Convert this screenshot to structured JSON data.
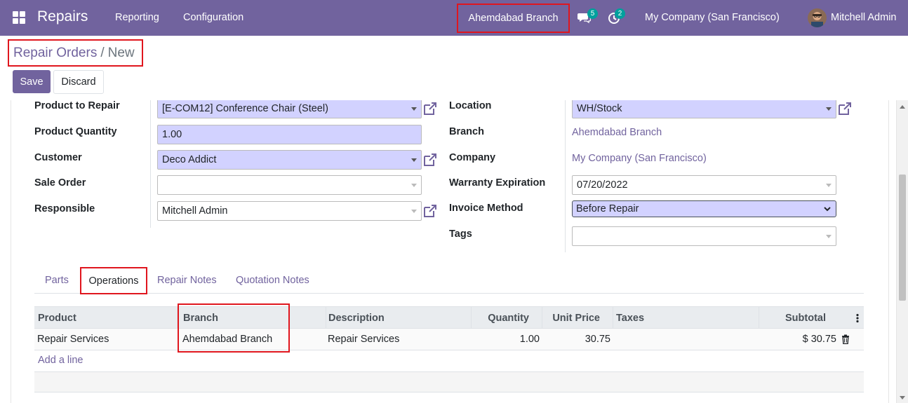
{
  "navbar": {
    "app_name": "Repairs",
    "menus": [
      "Reporting",
      "Configuration"
    ],
    "branch": "Ahemdabad Branch",
    "messages_count": "5",
    "activities_count": "2",
    "company": "My Company (San Francisco)",
    "user": "Mitchell Admin"
  },
  "breadcrumb": {
    "parent": "Repair Orders",
    "separator": "/",
    "current": "New"
  },
  "buttons": {
    "save": "Save",
    "discard": "Discard"
  },
  "form": {
    "left": {
      "product_label": "Product to Repair",
      "product_value": "[E-COM12] Conference Chair (Steel)",
      "qty_label": "Product Quantity",
      "qty_value": "1.00",
      "customer_label": "Customer",
      "customer_value": "Deco Addict",
      "sale_order_label": "Sale Order",
      "sale_order_value": "",
      "responsible_label": "Responsible",
      "responsible_value": "Mitchell Admin"
    },
    "right": {
      "location_label": "Location",
      "location_value": "WH/Stock",
      "branch_label": "Branch",
      "branch_value": "Ahemdabad Branch",
      "company_label": "Company",
      "company_value": "My Company (San Francisco)",
      "warranty_label": "Warranty Expiration",
      "warranty_value": "07/20/2022",
      "invoice_label": "Invoice Method",
      "invoice_value": "Before Repair",
      "tags_label": "Tags",
      "tags_value": ""
    }
  },
  "tabs": [
    "Parts",
    "Operations",
    "Repair Notes",
    "Quotation Notes"
  ],
  "active_tab": "Operations",
  "table": {
    "headers": [
      "Product",
      "Branch",
      "Description",
      "Quantity",
      "Unit Price",
      "Taxes",
      "Subtotal"
    ],
    "rows": [
      {
        "product": "Repair Services",
        "branch": "Ahemdabad Branch",
        "description": "Repair Services",
        "quantity": "1.00",
        "unit_price": "30.75",
        "taxes": "",
        "subtotal": "$ 30.75"
      }
    ],
    "add_line": "Add a line"
  },
  "colors": {
    "brand": "#71639e",
    "highlight_border": "#e0161e",
    "required_field": "#d2d2ff",
    "badge": "#00a09d"
  },
  "icons": [
    "apps-grid-icon",
    "chat-icon",
    "activity-clock-icon",
    "external-link-icon",
    "trash-icon",
    "kebab-menu-icon"
  ]
}
